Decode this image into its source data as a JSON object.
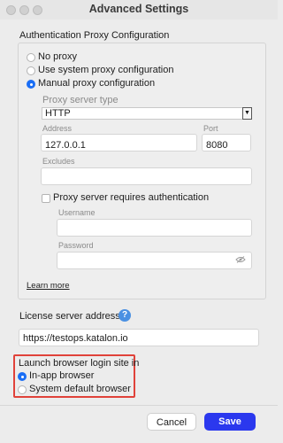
{
  "window": {
    "title": "Advanced Settings"
  },
  "proxy": {
    "section_title": "Authentication Proxy Configuration",
    "options": [
      "No proxy",
      "Use system proxy configuration",
      "Manual proxy configuration"
    ],
    "selected_option": "Manual proxy configuration",
    "server_type_label": "Proxy server type",
    "server_type_value": "HTTP",
    "address_label": "Address",
    "address_value": "127.0.0.1",
    "port_label": "Port",
    "port_value": "8080",
    "excludes_label": "Excludes",
    "excludes_value": "",
    "auth_checkbox_label": "Proxy server requires authentication",
    "auth_checked": false,
    "username_label": "Username",
    "username_value": "",
    "password_label": "Password",
    "password_value": "",
    "learn_more": "Learn more"
  },
  "license": {
    "label": "License server address",
    "value": "https://testops.katalon.io"
  },
  "browser_login": {
    "label": "Launch browser login site in",
    "options": [
      "In-app browser",
      "System default browser"
    ],
    "selected_option": "In-app browser"
  },
  "footer": {
    "cancel_label": "Cancel",
    "save_label": "Save"
  },
  "colors": {
    "accent": "#1a6ef5",
    "save_button": "#2b38ee",
    "highlight": "#e0423a"
  },
  "icons": [
    "help-icon",
    "eye-slash-icon"
  ]
}
